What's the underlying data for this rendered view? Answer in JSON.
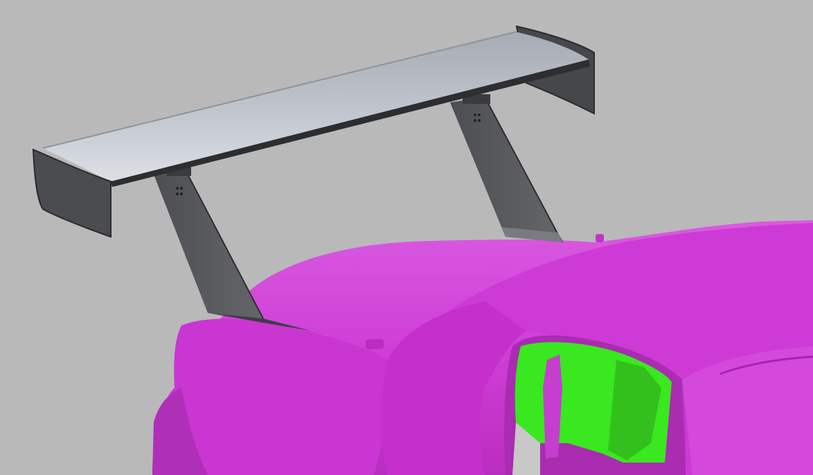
{
  "viewport": {
    "background_color": "#b9b9b9"
  },
  "scene": {
    "objects": [
      {
        "id": "rear-wing",
        "kind": "cad-surface",
        "color": "#bfc5cd"
      },
      {
        "id": "wing-endplates",
        "kind": "cad-surface",
        "color": "#4a4b4f"
      },
      {
        "id": "wing-uprights",
        "kind": "cad-surface",
        "color": "#55565a"
      },
      {
        "id": "car-body-scan",
        "kind": "scan-mesh",
        "color": "#d23ed8"
      },
      {
        "id": "interior-scan",
        "kind": "scan-mesh",
        "color": "#39e81f"
      }
    ]
  }
}
